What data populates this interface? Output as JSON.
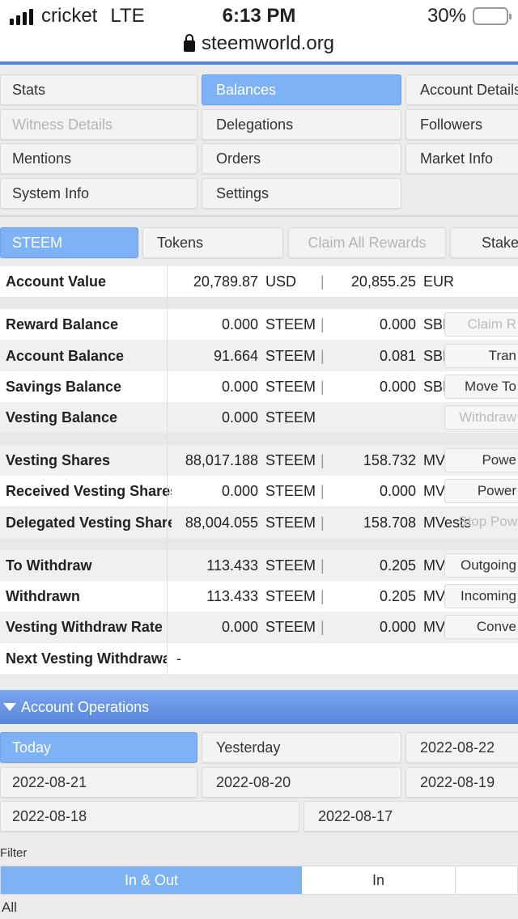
{
  "status_bar": {
    "carrier": "cricket",
    "network": "LTE",
    "time": "6:13 PM",
    "battery": "30%",
    "battery_level": 0.3,
    "url": "steemworld.org"
  },
  "main_nav": [
    {
      "label": "Stats"
    },
    {
      "label": "Balances"
    },
    {
      "label": "Account Details"
    },
    {
      "label": "Witness Details"
    },
    {
      "label": "Delegations"
    },
    {
      "label": "Followers"
    },
    {
      "label": "Mentions"
    },
    {
      "label": "Orders"
    },
    {
      "label": "Market Info"
    },
    {
      "label": "System Info"
    },
    {
      "label": "Settings"
    }
  ],
  "sub_tabs": {
    "steem": "STEEM",
    "tokens": "Tokens",
    "claim_all": "Claim All Rewards",
    "stake": "Stake"
  },
  "account_value": {
    "label": "Account Value",
    "value1": "20,789.87",
    "unit1": "USD",
    "sep": "|",
    "value2": "20,855.25",
    "unit2": "EUR"
  },
  "balances": [
    {
      "label": "Reward Balance",
      "value1": "0.000",
      "unit1": "STEEM",
      "sep": "|",
      "value2": "0.000",
      "unit2": "SBD",
      "action": "Claim R"
    },
    {
      "label": "Account Balance",
      "value1": "91.664",
      "unit1": "STEEM",
      "sep": "|",
      "value2": "0.081",
      "unit2": "SBD",
      "action": "Tran"
    },
    {
      "label": "Savings Balance",
      "value1": "0.000",
      "unit1": "STEEM",
      "sep": "|",
      "value2": "0.000",
      "unit2": "SBD",
      "action": "Move To"
    },
    {
      "label": "Vesting Balance",
      "value1": "0.000",
      "unit1": "STEEM",
      "sep": "",
      "value2": "",
      "unit2": "",
      "action": "Withdraw"
    }
  ],
  "vesting": [
    {
      "label": "Vesting Shares",
      "value1": "88,017.188",
      "unit1": "STEEM",
      "sep": "|",
      "value2": "158.732",
      "unit2": "MV",
      "action": "Powe"
    },
    {
      "label": "Received Vesting Shares",
      "value1": "0.000",
      "unit1": "STEEM",
      "sep": "|",
      "value2": "0.000",
      "unit2": "MV",
      "action": "Power"
    },
    {
      "label": "Delegated Vesting Share",
      "value1": "88,004.055",
      "unit1": "STEEM",
      "sep": "|",
      "value2": "158.708",
      "unit2": "MVests",
      "action": "Stop Pow"
    }
  ],
  "withdraw": [
    {
      "label": "To Withdraw",
      "value1": "113.433",
      "unit1": "STEEM",
      "sep": "|",
      "value2": "0.205",
      "unit2": "MV",
      "action": "Outgoing"
    },
    {
      "label": "Withdrawn",
      "value1": "113.433",
      "unit1": "STEEM",
      "sep": "|",
      "value2": "0.205",
      "unit2": "MV",
      "action": "Incoming"
    },
    {
      "label": "Vesting Withdraw Rate",
      "value1": "0.000",
      "unit1": "STEEM",
      "sep": "|",
      "value2": "0.000",
      "unit2": "MV",
      "action": "Conve"
    },
    {
      "label": "Next Vesting Withdrawal",
      "value1": "-",
      "unit1": "",
      "sep": "",
      "value2": "",
      "unit2": "",
      "action": ""
    }
  ],
  "operations": {
    "title": "Account Operations",
    "days": [
      "Today",
      "Yesterday",
      "2022-08-22",
      "2022-08-21",
      "2022-08-20",
      "2022-08-19",
      "2022-08-18",
      "2022-08-17"
    ],
    "filter_label": "Filter",
    "filter_tabs": [
      "In & Out",
      "In"
    ],
    "all_label": "All"
  },
  "colors": {
    "accent": "#7eb2f6",
    "header": "#5a86dc"
  }
}
